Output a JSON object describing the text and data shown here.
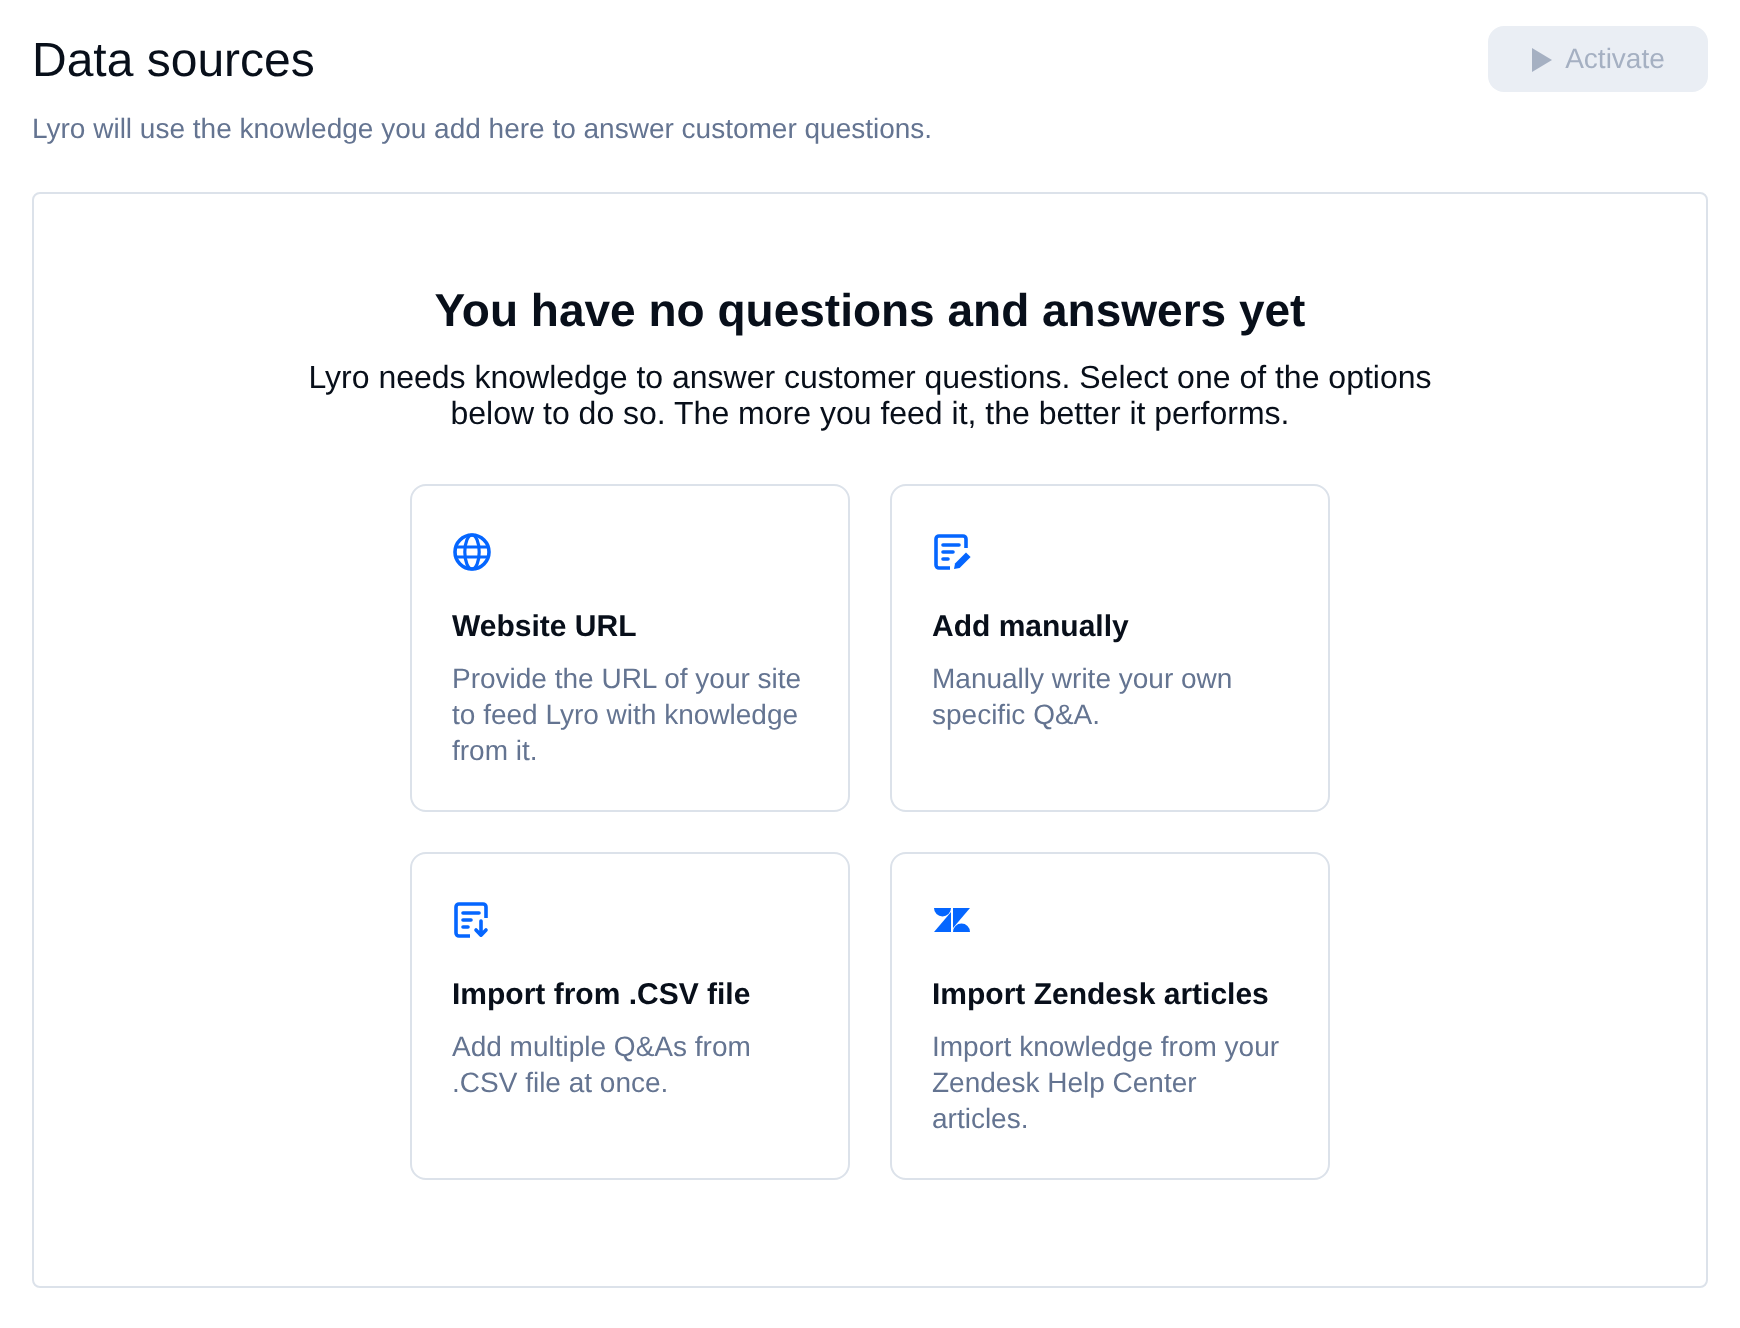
{
  "header": {
    "title": "Data sources",
    "subtitle": "Lyro will use the knowledge you add here to answer customer questions.",
    "activate_button": {
      "label": "Activate",
      "disabled": true
    }
  },
  "empty_state": {
    "heading": "You have no questions and answers yet",
    "description": "Lyro needs knowledge to answer customer questions. Select one of the options below to do so. The more you feed it, the better it performs.",
    "options": [
      {
        "kind": "globe",
        "title": "Website URL",
        "description": "Provide the URL of your site to feed Lyro with knowledge from it."
      },
      {
        "kind": "note-pencil",
        "title": "Add manually",
        "description": "Manually write your own specific Q&A."
      },
      {
        "kind": "list-download",
        "title": "Import from .CSV file",
        "description": "Add multiple Q&As from .CSV file at once."
      },
      {
        "kind": "zendesk",
        "title": "Import Zendesk articles",
        "description": "Import knowledge from your Zendesk Help Center articles."
      }
    ]
  }
}
